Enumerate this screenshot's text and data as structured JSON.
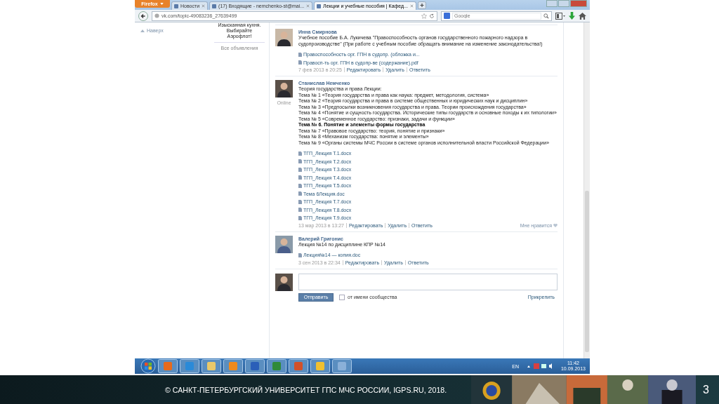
{
  "browser": {
    "menu_button": "Firefox",
    "tabs": [
      {
        "title": "Новости",
        "selected": false
      },
      {
        "title": "(17) Входящие - nemchenko-st@mai...",
        "selected": false
      },
      {
        "title": "Лекции и учебные пособия | Кафед...",
        "selected": true
      }
    ],
    "url": "vk.com/topic-49083236_27639499",
    "search": {
      "placeholder": "Google"
    }
  },
  "left_column": {
    "back_to_top": "Наверх"
  },
  "ad": {
    "text": "Изысканная кухня. Выбирайте Аэрофлот!",
    "all_ads": "Все объявления"
  },
  "posts": [
    {
      "author": "Инна Смирнова",
      "lines": [
        {
          "text": "Учебное пособие Б.А. Лукичева \"Правоспособность органов государственного пожарного надзора в судопроизводстве\" (При работе с учебным пособие обращать внимание на изменение законодательства!)",
          "bold": false
        }
      ],
      "attachments": [
        "Правоспособность орг. ГПН в судопр. (обложка и...",
        "Правосп-ть орг. ГПН в судопр-ве (содержание).pdf"
      ],
      "date": "7 фев 2013 в 20:25",
      "actions": [
        "Редактировать",
        "Удалить",
        "Ответить"
      ]
    },
    {
      "author": "Станислав Немченко",
      "online": true,
      "online_label": "Online",
      "lines": [
        {
          "text": "Теория государства и права Лекции:",
          "bold": false
        },
        {
          "text": "Тема № 1 «Теория государства и права как наука: предмет, методология, система»",
          "bold": false
        },
        {
          "text": "Тема № 2 «Теория государства и права в системе общественных и юридических наук и дисциплин»",
          "bold": false
        },
        {
          "text": "Тема № 3 «Предпосылки возникновения государства и права. Теории происхождения государства»",
          "bold": false
        },
        {
          "text": "Тема № 4 «Понятие и сущность государства. Исторические типы государств и основные походы к их типологии»",
          "bold": false
        },
        {
          "text": "Тема № 5 «Современное государство: признаки, задачи и функции»",
          "bold": false
        },
        {
          "text": "Тема № 6. Понятие и элементы формы государства",
          "bold": true
        },
        {
          "text": "Тема № 7 «Правовое государство: теория, понятие и признаки»",
          "bold": false
        },
        {
          "text": "Тема № 8 «Механизм государства: понятие и элементы»",
          "bold": false
        },
        {
          "text": "Тема № 9 «Органы системы МЧС России в системе органов исполнительной власти Российской Федерации»",
          "bold": false
        }
      ],
      "attachments": [
        "ТГП_Лекция Т.1.docx",
        "ТГП_Лекция Т.2.docx",
        "ТГП_Лекция Т.3.docx",
        "ТГП_Лекция Т.4.docx",
        "ТГП_Лекция Т.5.docx",
        "Тема 6Лекция.doc",
        "ТГП_Лекция Т.7.docx",
        "ТГП_Лекция Т.8.docx",
        "ТГП_Лекция Т.9.docx"
      ],
      "date": "13 мар 2013 в 13:27",
      "actions": [
        "Редактировать",
        "Удалить",
        "Ответить"
      ],
      "like": "Мне нравится"
    },
    {
      "author": "Валерий Григонис",
      "lines": [
        {
          "text": "Лекция №14 по дисциплине КПР №14",
          "bold": false
        }
      ],
      "attachments": [
        "Лекция№14 — копия.doc"
      ],
      "date": "3 сен 2013 в 22:34",
      "actions": [
        "Редактировать",
        "Удалить",
        "Ответить"
      ]
    }
  ],
  "comment_form": {
    "send": "Отправить",
    "on_behalf_checked": false,
    "on_behalf": "от имени сообщества",
    "attach": "Прикрепить"
  },
  "taskbar": {
    "language": "EN",
    "time": "11:42",
    "date": "10.09.2013"
  },
  "footer": {
    "copyright": "© САНКТ-ПЕТЕРБУРГСКИЙ УНИВЕРСИТЕТ ГПС МЧС РОССИИ, IGPS.RU, 2018.",
    "slide_number": "3"
  }
}
